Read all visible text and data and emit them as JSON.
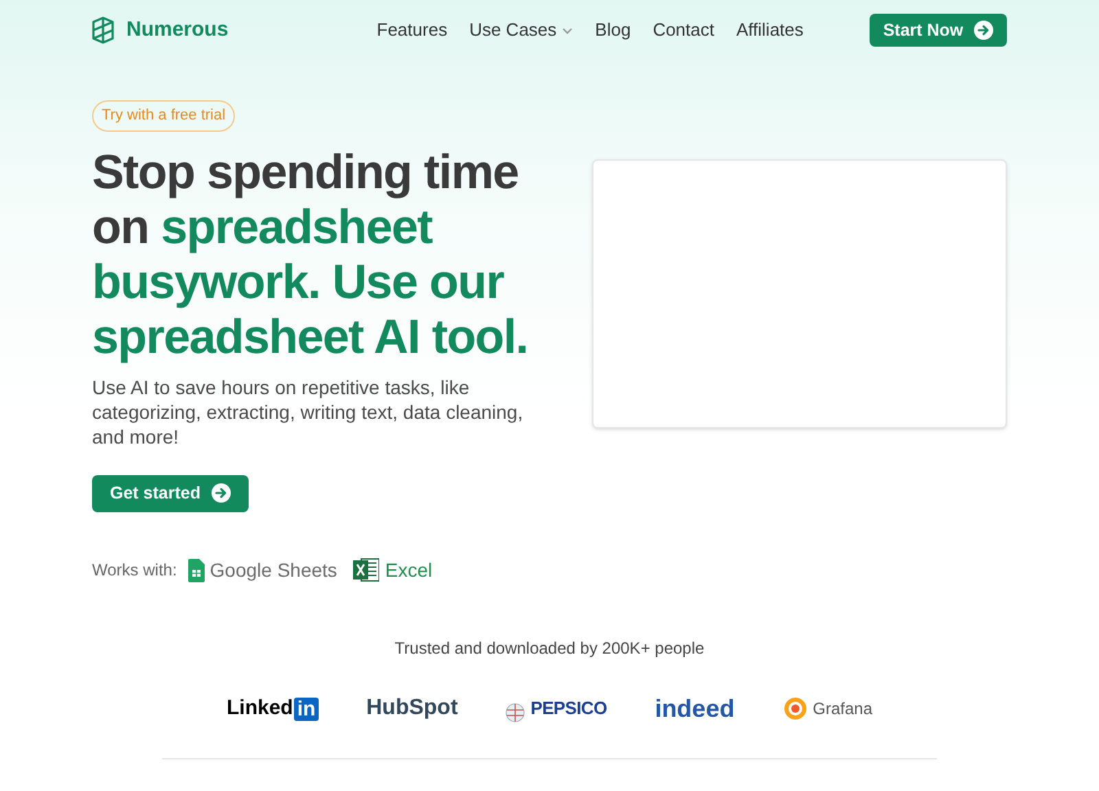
{
  "brand": {
    "name": "Numerous"
  },
  "nav": [
    {
      "label": "Features",
      "has_menu": false
    },
    {
      "label": "Use Cases",
      "has_menu": true
    },
    {
      "label": "Blog",
      "has_menu": false
    },
    {
      "label": "Contact",
      "has_menu": false
    },
    {
      "label": "Affiliates",
      "has_menu": false
    }
  ],
  "cta": {
    "label": "Start Now"
  },
  "hero": {
    "badge": "Try with a free trial",
    "headline_plain": "Stop spending time on ",
    "headline_accent": "spreadsheet busywork. Use our spreadsheet AI tool.",
    "description": "Use AI to save hours on repetitive tasks, like categorizing, extracting, writing text, data cleaning, and more!",
    "button": "Get started",
    "works_with_label": "Works with:",
    "integrations": [
      {
        "kind": "sheets",
        "label": "Google Sheets"
      },
      {
        "kind": "excel",
        "label": "Excel"
      }
    ]
  },
  "trusted": {
    "text": "Trusted and downloaded by 200K+ people",
    "logos": [
      {
        "kind": "linkedin",
        "text": "Linked",
        "badge": "in"
      },
      {
        "kind": "hubspot",
        "text": "HubSpot"
      },
      {
        "kind": "pepsico",
        "text": "PEPSICO"
      },
      {
        "kind": "indeed",
        "text": "indeed"
      },
      {
        "kind": "grafana",
        "text": "Grafana"
      }
    ]
  }
}
